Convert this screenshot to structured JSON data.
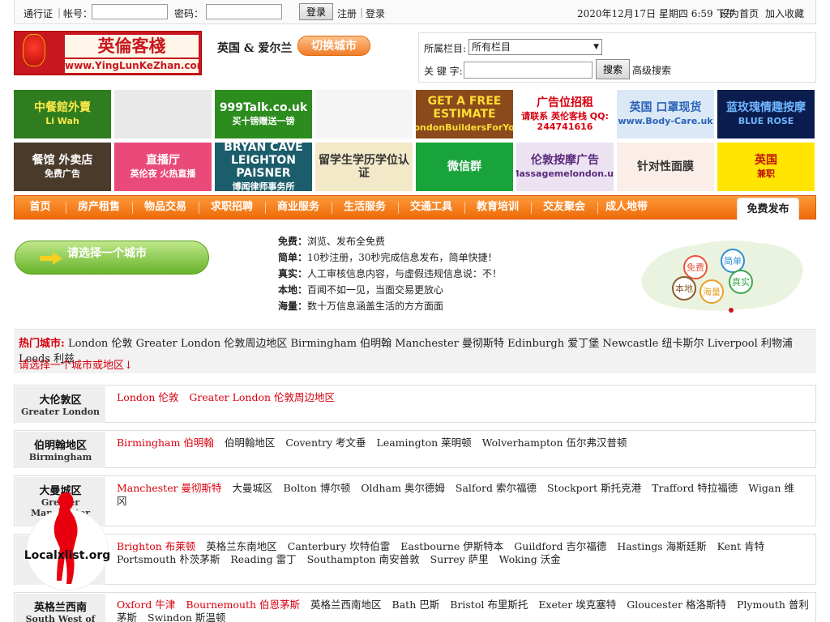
{
  "topbar": {
    "passport_label": "通行证",
    "account_label": "帐号：",
    "password_label": "密码：",
    "login_button": "登录",
    "register_link": "注册",
    "login_link": "登录",
    "sep": "|",
    "datetime": "2020年12月17日 星期四 6:59 下午",
    "set_home": "设为首页",
    "add_favorite": "加入收藏"
  },
  "header": {
    "logo_cn": "英倫客棧",
    "logo_url": "www.YingLunKeZhan.com",
    "region": "英国 & 爱尔兰",
    "switch_city": "切换城市"
  },
  "search": {
    "category_label": "所属栏目:",
    "category_value": "所有栏目",
    "keyword_label": "关 键 字:",
    "button": "搜索",
    "advanced": "高级搜索"
  },
  "ads": [
    {
      "t1": "中餐館外賣",
      "t2": "Li Wah",
      "bg": "#2f7d1e",
      "fg": "#ffe94a"
    },
    {
      "t1": "",
      "t2": "",
      "bg": "#e9e9e9",
      "fg": "#555"
    },
    {
      "t1": "999Talk.co.uk",
      "t2": "买十镑赠送一镑",
      "bg": "#2c8c1e",
      "fg": "#ffffff"
    },
    {
      "t1": "",
      "t2": "",
      "bg": "#f5f5f5",
      "fg": "#e34"
    },
    {
      "t1": "GET A FREE ESTIMATE",
      "t2": "LondonBuildersForYou",
      "bg": "#8a4a1c",
      "fg": "#ffdd33"
    },
    {
      "t1": "广告位招租",
      "t2": "请联系 英伦客栈 QQ: 244741616",
      "bg": "#ffffff",
      "fg": "#d8000e"
    },
    {
      "t1": "英国 口罩现货",
      "t2": "www.Body-Care.uk",
      "bg": "#dbe9f7",
      "fg": "#2a62b8"
    },
    {
      "t1": "蓝玫瑰情趣按摩",
      "t2": "BLUE ROSE",
      "bg": "#0b1d4e",
      "fg": "#6fb6ff"
    },
    {
      "t1": "餐馆 外卖店",
      "t2": "免费广告",
      "bg": "#4a3a2a",
      "fg": "#ffffff"
    },
    {
      "t1": "直播厅",
      "t2": "英伦夜 火热直播",
      "bg": "#e94a7a",
      "fg": "#ffffff"
    },
    {
      "t1": "BRYAN CAVE LEIGHTON PAISNER",
      "t2": "博闻律师事务所",
      "bg": "#1b5d6b",
      "fg": "#ffffff"
    },
    {
      "t1": "留学生学历学位认证",
      "t2": "",
      "bg": "#f2e9c8",
      "fg": "#333333"
    },
    {
      "t1": "微信群",
      "t2": "",
      "bg": "#19a33b",
      "fg": "#ffffff"
    },
    {
      "t1": "伦敦按摩广告",
      "t2": "Massagemelondon.uk",
      "bg": "#ece2f2",
      "fg": "#5a2a7a"
    },
    {
      "t1": "针对性面膜",
      "t2": "",
      "bg": "#fbeee8",
      "fg": "#333333"
    },
    {
      "t1": "英国",
      "t2": "兼职",
      "bg": "#ffe500",
      "fg": "#c0140e"
    }
  ],
  "nav": {
    "items": [
      "首页",
      "房产租售",
      "物品交易",
      "求职招聘",
      "商业服务",
      "生活服务",
      "交通工具",
      "教育培训",
      "交友聚会",
      "成人地带"
    ],
    "free_post": "免费发布"
  },
  "intro": {
    "pick_city": "请选择一个城市",
    "features": [
      {
        "key": "免费：",
        "text": "浏览、发布全免费"
      },
      {
        "key": "简单：",
        "text": "10秒注册，30秒完成信息发布，简单快捷！"
      },
      {
        "key": "真实：",
        "text": "人工审核信息内容，与虚假违规信息说：不！"
      },
      {
        "key": "本地：",
        "text": "百闻不如一见，当面交易更放心"
      },
      {
        "key": "海量：",
        "text": "数十万信息涵盖生活的方方面面"
      }
    ],
    "bubbles": [
      "免费",
      "简单",
      "本地",
      "海量",
      "真实"
    ]
  },
  "hot": {
    "title": "热门城市:",
    "cities": "London 伦敦 Greater London 伦敦周边地区 Birmingham 伯明翰 Manchester 曼彻斯特 Edinburgh 爱丁堡 Newcastle 纽卡斯尔 Liverpool 利物浦 Leeds 利兹",
    "select_prompt": "请选择一个城市或地区↓"
  },
  "regions": [
    {
      "cn": "大伦敦区",
      "en": "Greater London",
      "links": [
        {
          "t": "London 伦敦",
          "hot": true
        },
        {
          "t": "Greater London 伦敦周边地区",
          "hot": true
        }
      ]
    },
    {
      "cn": "伯明翰地区",
      "en": "Birmingham",
      "links": [
        {
          "t": "Birmingham 伯明翰",
          "hot": true
        },
        {
          "t": "伯明翰地区",
          "hot": false
        },
        {
          "t": "Coventry 考文垂",
          "hot": false
        },
        {
          "t": "Leamington 莱明顿",
          "hot": false
        },
        {
          "t": "Wolverhampton 伍尔弗汉普顿",
          "hot": false
        }
      ]
    },
    {
      "cn": "大曼城区",
      "en": "Greater Manchester",
      "links": [
        {
          "t": "Manchester 曼彻斯特",
          "hot": true
        },
        {
          "t": "大曼城区",
          "hot": false
        },
        {
          "t": "Bolton 博尔顿",
          "hot": false
        },
        {
          "t": "Oldham 奥尔德姆",
          "hot": false
        },
        {
          "t": "Salford 索尔福德",
          "hot": false
        },
        {
          "t": "Stockport 斯托克港",
          "hot": false
        },
        {
          "t": "Trafford 特拉福德",
          "hot": false
        },
        {
          "t": "Wigan 维冈",
          "hot": false
        }
      ]
    },
    {
      "cn": "英格兰东南",
      "en": "South East",
      "links": [
        {
          "t": "Brighton 布莱顿",
          "hot": true
        },
        {
          "t": "英格兰东南地区",
          "hot": false
        },
        {
          "t": "Canterbury 坎特伯雷",
          "hot": false
        },
        {
          "t": "Eastbourne 伊斯特本",
          "hot": false
        },
        {
          "t": "Guildford 吉尔福德",
          "hot": false
        },
        {
          "t": "Hastings 海斯廷斯",
          "hot": false
        },
        {
          "t": "Kent 肯特",
          "hot": false
        },
        {
          "t": "Portsmouth 朴茨茅斯",
          "hot": false
        },
        {
          "t": "Reading 雷丁",
          "hot": false
        },
        {
          "t": "Southampton 南安普敦",
          "hot": false
        },
        {
          "t": "Surrey 萨里",
          "hot": false
        },
        {
          "t": "Woking 沃金",
          "hot": false
        }
      ]
    },
    {
      "cn": "英格兰西南",
      "en": "South West of",
      "links": [
        {
          "t": "Oxford 牛津",
          "hot": true
        },
        {
          "t": "Bournemouth 伯恩茅斯",
          "hot": true
        },
        {
          "t": "英格兰西南地区",
          "hot": false
        },
        {
          "t": "Bath 巴斯",
          "hot": false
        },
        {
          "t": "Bristol 布里斯托",
          "hot": false
        },
        {
          "t": "Exeter 埃克塞特",
          "hot": false
        },
        {
          "t": "Gloucester 格洛斯特",
          "hot": false
        },
        {
          "t": "Plymouth 普利茅斯",
          "hot": false
        },
        {
          "t": "Swindon 斯温顿",
          "hot": false
        }
      ]
    }
  ],
  "watermark": "Localxlist.org",
  "colors": {
    "nav_orange": "#f07c1a",
    "hot_red": "#d8000e",
    "button_green": "#68b32a"
  }
}
